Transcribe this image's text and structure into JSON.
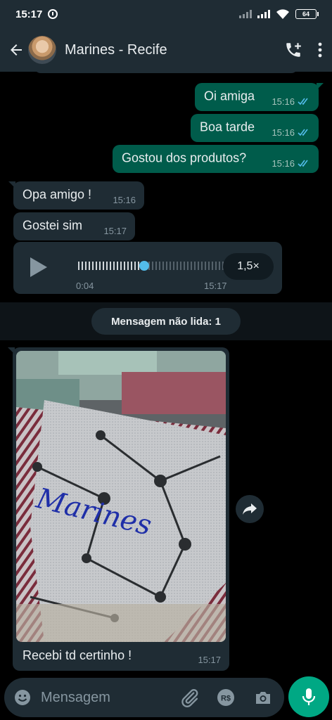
{
  "status_bar": {
    "time": "15:17",
    "battery": "64"
  },
  "header": {
    "contact_name": "Marines - Recife"
  },
  "messages": [
    {
      "dir": "out",
      "text": "Oi amiga",
      "time": "15:16"
    },
    {
      "dir": "out",
      "text": "Boa tarde",
      "time": "15:16"
    },
    {
      "dir": "out",
      "text": "Gostou dos produtos?",
      "time": "15:16"
    },
    {
      "dir": "in",
      "text": "Opa amigo !",
      "time": "15:16"
    },
    {
      "dir": "in",
      "text": "Gostei sim",
      "time": "15:17"
    }
  ],
  "voice_message": {
    "duration": "0:04",
    "time": "15:17",
    "speed": "1,5×",
    "progress": 0.42
  },
  "unread_divider": "Mensagem não lida: 1",
  "image_message": {
    "photo_handwriting": "Marines",
    "caption": "Recebi td certinho !",
    "time": "15:17"
  },
  "input": {
    "placeholder": "Mensagem"
  },
  "colors": {
    "outgoing_bubble": "#005c4b",
    "incoming_bubble": "#1f2c34",
    "accent": "#00a884",
    "read_ticks": "#53bdeb"
  },
  "icons": [
    "back-arrow-icon",
    "add-call-icon",
    "more-vert-icon",
    "play-icon",
    "forward-icon",
    "emoji-icon",
    "attach-icon",
    "payment-icon",
    "camera-icon",
    "mic-icon"
  ]
}
